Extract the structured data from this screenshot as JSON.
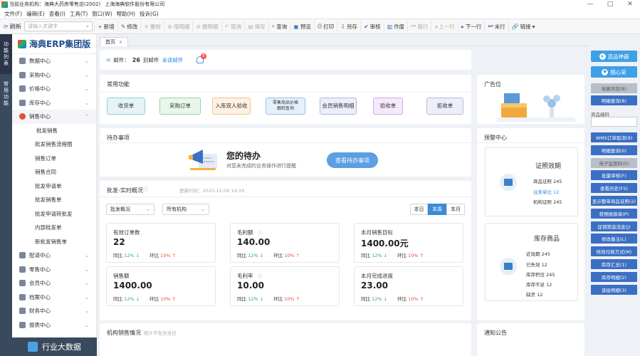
{
  "window": {
    "title": "当前业务机构：海典大药房零售店(2002)",
    "company": "上海海典软件股份有限公司",
    "controls": [
      "—",
      "□",
      "✕"
    ]
  },
  "menu": [
    "文件(F)",
    "编辑(E)",
    "查看(I)",
    "工具(T)",
    "窗口(W)",
    "帮助(H)",
    "投诉(G)"
  ],
  "toolbar": {
    "refresh": "刷新",
    "search_placeholder": "请输入关键字",
    "buttons": [
      {
        "icon": "+",
        "label": "新增",
        "enabled": true
      },
      {
        "icon": "✎",
        "label": "修改",
        "enabled": true
      },
      {
        "icon": "✕",
        "label": "删除",
        "enabled": false
      },
      {
        "icon": "⊕",
        "label": "增明细",
        "enabled": false
      },
      {
        "icon": "⊖",
        "label": "删明细",
        "enabled": false
      },
      {
        "icon": "↶",
        "label": "取消",
        "enabled": false
      },
      {
        "icon": "▤",
        "label": "保存",
        "enabled": false
      },
      {
        "icon": "⌕",
        "label": "查询",
        "enabled": true
      },
      {
        "icon": "▣",
        "label": "预览",
        "enabled": true
      },
      {
        "icon": "⎙",
        "label": "打印",
        "enabled": true
      },
      {
        "icon": "⇩",
        "label": "另存",
        "enabled": true
      },
      {
        "icon": "✔",
        "label": "审核",
        "enabled": true
      },
      {
        "icon": "▥",
        "label": "作废",
        "enabled": true
      },
      {
        "icon": "⏮",
        "label": "首行",
        "enabled": false
      },
      {
        "icon": "◂",
        "label": "上一行",
        "enabled": false
      },
      {
        "icon": "▸",
        "label": "下一行",
        "enabled": true
      },
      {
        "icon": "⏭",
        "label": "末行",
        "enabled": true
      },
      {
        "icon": "🔗",
        "label": "链接",
        "enabled": true
      }
    ]
  },
  "left_strip": [
    "功能列表",
    "常用功能"
  ],
  "sidebar": {
    "logo": "海典ERP集团版",
    "items": [
      {
        "label": "数据中心",
        "arrow": "⌄"
      },
      {
        "label": "采购中心",
        "arrow": "⌄"
      },
      {
        "label": "价格中心",
        "arrow": "⌄"
      },
      {
        "label": "库存中心",
        "arrow": "⌄"
      },
      {
        "label": "销售中心",
        "arrow": "⌃"
      }
    ],
    "sub_items": [
      "批发销售",
      "批发销售流程图",
      "销售订单",
      "销售合同",
      "批发申请单",
      "批发销售单",
      "批发申请转批发",
      "内部批发单",
      "新批发销售单"
    ],
    "items_after": [
      {
        "label": "配请中心",
        "arrow": "⌄"
      },
      {
        "label": "零售中心",
        "arrow": "⌄"
      },
      {
        "label": "会员中心",
        "arrow": "⌄"
      },
      {
        "label": "档案中心",
        "arrow": "⌄"
      },
      {
        "label": "财务中心",
        "arrow": "⌄"
      },
      {
        "label": "报表中心",
        "arrow": "⌄"
      }
    ],
    "bottom": "行业大数据"
  },
  "tabs": [
    {
      "label": "首页",
      "close": "✕"
    }
  ],
  "mail": {
    "prefix": "邮件：",
    "count": "26",
    "unit": "封邮件",
    "unread": "未读邮件",
    "badge": "8"
  },
  "common": {
    "title": "常用功能",
    "buttons": [
      {
        "label": "收货单",
        "bg": "#e6f4f8",
        "border": "#8fcfe0"
      },
      {
        "label": "采购订单",
        "bg": "#e8f7ea",
        "border": "#96d49e"
      },
      {
        "label": "入库双人验收",
        "bg": "#fdf1e3",
        "border": "#f0c48a"
      },
      {
        "label": "零售商品价格\n跟踪查询",
        "bg": "#e6f0fa",
        "border": "#9cc0e6"
      },
      {
        "label": "会员销售明细",
        "bg": "#eceefa",
        "border": "#b0b6e6"
      },
      {
        "label": "验收单",
        "bg": "#f5eafa",
        "border": "#d5a9e8"
      },
      {
        "label": "拒收单",
        "bg": "#eeeef8",
        "border": "#b9b9e0"
      }
    ]
  },
  "todo": {
    "title": "待办事项",
    "heading": "您的待办",
    "sub": "对您未完成的业务操作进行提醒",
    "button": "查看待办事项"
  },
  "overview": {
    "title": "批发-实时概况",
    "update": "更新时间：2020-12-09  14:39",
    "select1": "批发概况",
    "select2": "所有机构",
    "segments": [
      "本日",
      "本周",
      "本月"
    ],
    "stats": [
      {
        "label": "有效订单数",
        "value": "22",
        "yoy": "12%",
        "yoy_dir": "down",
        "mom": "10%",
        "mom_dir": "up"
      },
      {
        "label": "毛利额",
        "value": "140.00",
        "yoy": "12%",
        "yoy_dir": "down",
        "mom": "10%",
        "mom_dir": "up"
      },
      {
        "label": "本月销售目标",
        "value": "1400.00元",
        "yoy": "12%",
        "yoy_dir": "down",
        "mom": "10%",
        "mom_dir": "up"
      },
      {
        "label": "销售额",
        "value": "1400.00",
        "yoy": "12%",
        "yoy_dir": "down",
        "mom": "10%",
        "mom_dir": "up"
      },
      {
        "label": "毛利率",
        "value": "10.00",
        "yoy": "12%",
        "yoy_dir": "down",
        "mom": "10%",
        "mom_dir": "up"
      },
      {
        "label": "本月完成进度",
        "value": "23.00",
        "yoy": "12%",
        "yoy_dir": "down",
        "mom": "10%",
        "mom_dir": "up"
      }
    ],
    "yoy_label": "同比",
    "mom_label": "环比"
  },
  "inst_sales": {
    "title": "机构销售情况",
    "note": "统计不包含当日"
  },
  "ad": {
    "title": "广告位"
  },
  "warning": {
    "title": "预警中心",
    "cert": {
      "title": "证照效期",
      "lines": [
        "商品证照  245",
        "往来单位  12",
        "机构证照  245"
      ]
    },
    "stock": {
      "title": "库存商品",
      "lines": [
        "近效期  245",
        "已失效  12",
        "库存积压  245",
        "库存不足  12",
        "缺货  12"
      ]
    }
  },
  "notice": {
    "title": "通知公告"
  },
  "right_panel": {
    "big_buttons": [
      "选品神器",
      "随心采"
    ],
    "gray1": "单据浏览(B)",
    "btn1": "明细查询(B)",
    "product_code_label": "商品编码",
    "buttons": [
      "WMS订单取消(9)",
      "明细查询(0)",
      "电子监管码(5)",
      "批量审核(F)",
      "查看历史(F5)",
      "显示整单商品证照(2)",
      "转预收款单(P)",
      "促销筛选消息(J)",
      "修改备注(L)",
      "修改付款方式(M)",
      "库存汇总(1)",
      "库存明细(2)",
      "该批明细(3)"
    ],
    "gray_indices": [
      2
    ]
  }
}
